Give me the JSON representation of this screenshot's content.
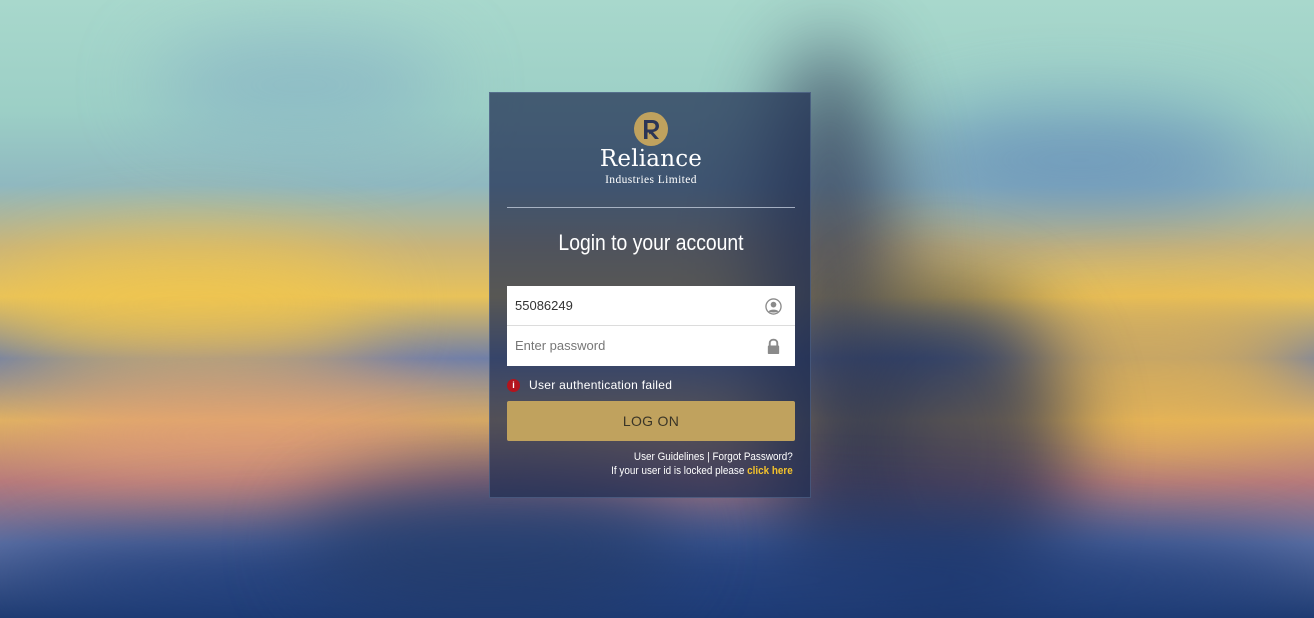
{
  "brand": {
    "name": "Reliance",
    "subtitle": "Industries Limited",
    "logo_icon": "reliance-logo-icon",
    "color": "#c0a25e"
  },
  "login": {
    "title": "Login to your account",
    "username_value": "55086249",
    "username_icon": "user-icon",
    "password_placeholder": "Enter password",
    "password_icon": "lock-icon",
    "error_message": "User authentication failed",
    "error_icon": "info-icon",
    "error_color": "#b3141d",
    "logon_label": "LOG ON",
    "user_guidelines": "User Guidelines",
    "separator": "|",
    "forgot_password": "Forgot Password?",
    "locked_text": "If your user id is locked please",
    "click_here": "click here",
    "link_highlight_color": "#f3c22b"
  }
}
